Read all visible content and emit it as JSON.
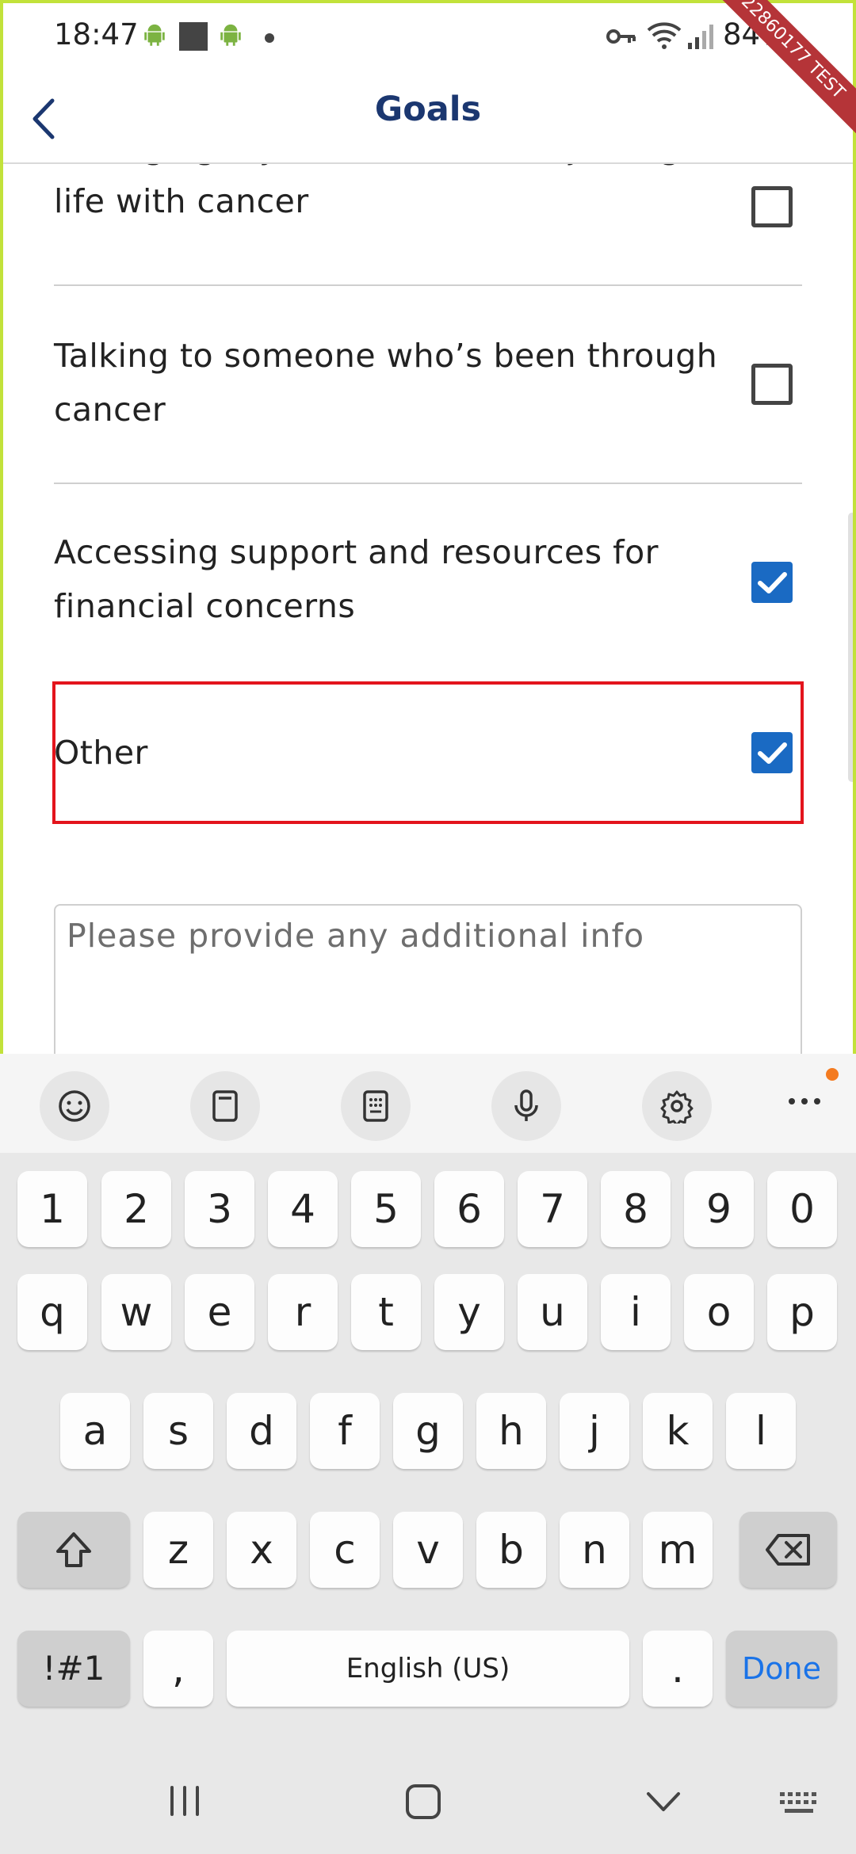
{
  "status_bar": {
    "time": "18:47",
    "battery": "84%",
    "test_label": "22860177 TEST"
  },
  "header": {
    "title": "Goals"
  },
  "goals": [
    {
      "label": "Managing my emotions and adjusting to life with cancer",
      "checked": false
    },
    {
      "label": "Talking to someone who’s been through cancer",
      "checked": false
    },
    {
      "label": "Accessing support and resources for financial concerns",
      "checked": true
    },
    {
      "label": "Other",
      "checked": true
    }
  ],
  "additional_info": {
    "placeholder": "Please provide any additional info",
    "value": ""
  },
  "keyboard": {
    "number_row": [
      "1",
      "2",
      "3",
      "4",
      "5",
      "6",
      "7",
      "8",
      "9",
      "0"
    ],
    "row1": [
      "q",
      "w",
      "e",
      "r",
      "t",
      "y",
      "u",
      "i",
      "o",
      "p"
    ],
    "row2": [
      "a",
      "s",
      "d",
      "f",
      "g",
      "h",
      "j",
      "k",
      "l"
    ],
    "row3": [
      "z",
      "x",
      "c",
      "v",
      "b",
      "n",
      "m"
    ],
    "symbols_label": "!#1",
    "comma": ",",
    "space_label": "English (US)",
    "period": ".",
    "done_label": "Done",
    "toolbar": [
      "emoji-icon",
      "clipboard-icon",
      "keypad-icon",
      "microphone-icon",
      "settings-icon",
      "more-icon"
    ]
  },
  "colors": {
    "accent": "#1a6ac3",
    "title": "#1b3770",
    "highlight": "#e3141c",
    "frame": "#c2e23a",
    "done_key": "#1a73e8"
  }
}
